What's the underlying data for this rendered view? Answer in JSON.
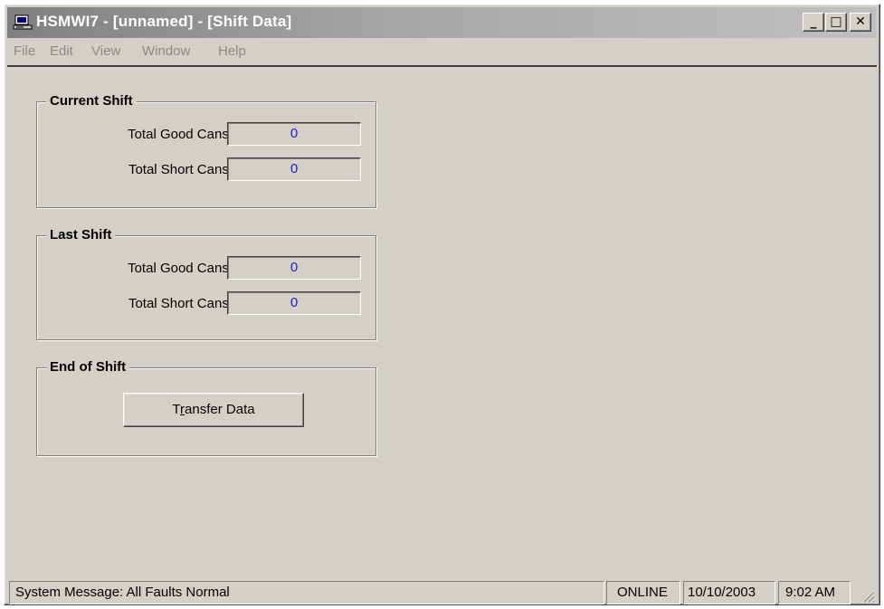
{
  "window": {
    "title": "HSMWI7 - [unnamed] - [Shift Data]",
    "minimize_label": "_",
    "maximize_label": "□",
    "close_label": "✕"
  },
  "menu": [
    "File",
    "Edit",
    "View",
    "Window",
    "Help"
  ],
  "current_shift": {
    "title": "Current Shift",
    "good_label": "Total Good Cans:",
    "good_value": "0",
    "short_label": "Total Short Cans:",
    "short_value": "0"
  },
  "last_shift": {
    "title": "Last Shift",
    "good_label": "Total Good Cans:",
    "good_value": "0",
    "short_label": "Total Short Cans:",
    "short_value": "0"
  },
  "end_of_shift": {
    "title": "End of Shift",
    "button_prefix": "T",
    "button_underlined": "r",
    "button_rest": "ansfer Data"
  },
  "status": {
    "message": "System Message:  All Faults Normal",
    "connection": "ONLINE",
    "date": "10/10/2003",
    "time": "9:02 AM"
  },
  "colors": {
    "title_gradient_start": "#808080",
    "title_gradient_end": "#c0c0c0",
    "value_text": "#1f1fd6",
    "face": "#d4d0c8"
  },
  "icons": {
    "app": "computer-icon",
    "grip": "resize-grip-icon"
  }
}
